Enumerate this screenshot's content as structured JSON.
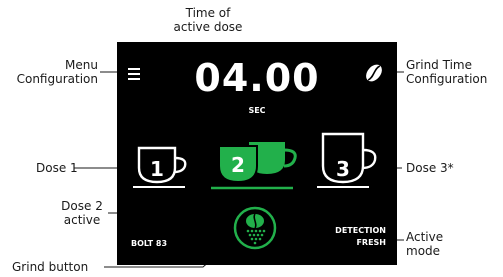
{
  "annotations": {
    "time_of_active_dose": "Time of\nactive dose",
    "menu_configuration": "Menu\nConfiguration",
    "grind_time_configuration": "Grind Time\nConfiguration",
    "dose_1": "Dose 1",
    "dose_2_active": "Dose 2\nactive",
    "dose_3": "Dose 3*",
    "active_mode": "Active\nmode",
    "grind_button": "Grind button"
  },
  "screen": {
    "dose_time": "04.00",
    "dose_unit": "SEC",
    "doses": [
      {
        "number": "1",
        "active": false
      },
      {
        "number": "2",
        "active": true
      },
      {
        "number": "3",
        "active": false
      }
    ],
    "grinder_name": "BOLT 83",
    "mode_line1": "DETECTION",
    "mode_line2": "FRESH"
  },
  "icons": {
    "menu": "hamburger-menu-icon",
    "grind_time": "coffee-bean-icon",
    "grind_button": "grind-button-icon"
  },
  "colors": {
    "screen_background": "#000000",
    "active_accent": "#22b04b",
    "text_on_screen": "#ffffff",
    "annotation_text": "#1a1a1a",
    "leader_line": "#1a1a1a"
  }
}
